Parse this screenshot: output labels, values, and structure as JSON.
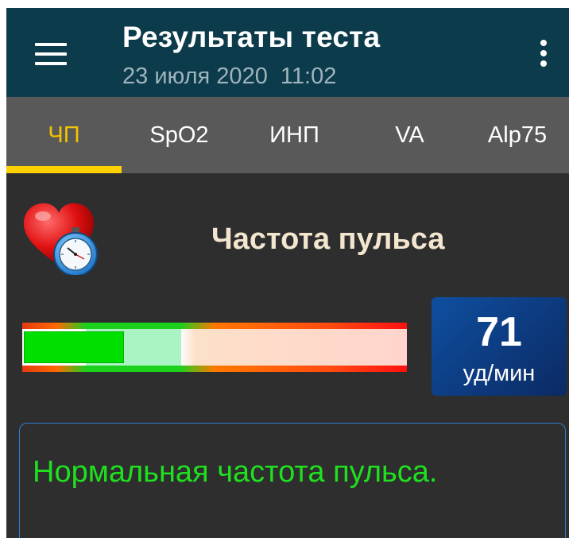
{
  "app_bar": {
    "title": "Результаты теста",
    "subtitle": "23 июля 2020  11:02"
  },
  "tabs": [
    {
      "label": "ЧП",
      "active": true
    },
    {
      "label": "SpO2",
      "active": false
    },
    {
      "label": "ИНП",
      "active": false
    },
    {
      "label": "VA",
      "active": false
    },
    {
      "label": "Alp75",
      "active": false
    }
  ],
  "section": {
    "title": "Частота пульса",
    "icon": "heart-with-stopwatch-icon"
  },
  "pulse_indicator": {
    "fill_fraction": 0.26
  },
  "reading": {
    "value": "71",
    "unit": "уд/мин"
  },
  "message": {
    "text": "Нормальная частота пульса."
  },
  "colors": {
    "app_bar": "#0c3b4c",
    "tab_bar": "#595959",
    "active_tab": "#f2c200",
    "background": "#2e2e2e",
    "value_box": "#0f4fa0",
    "normal_text": "#1fe01f"
  }
}
